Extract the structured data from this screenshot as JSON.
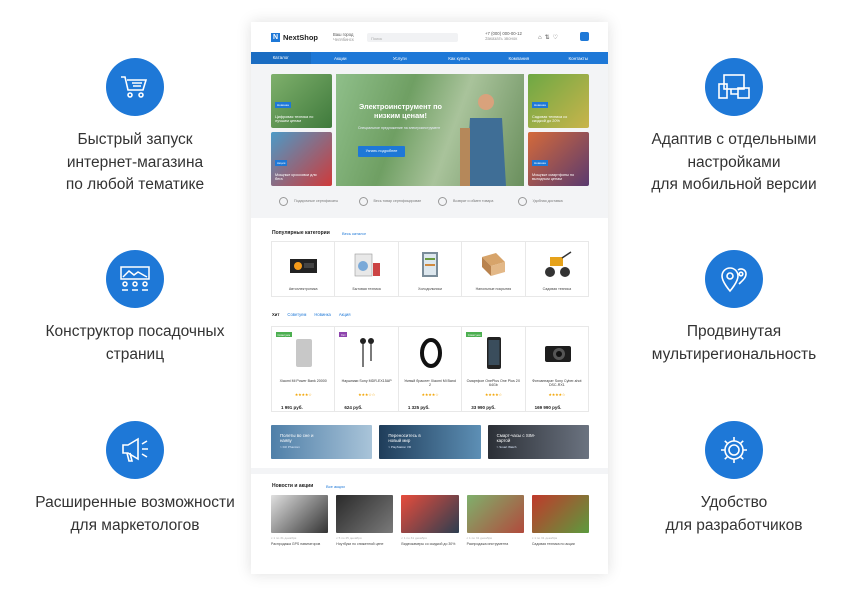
{
  "colors": {
    "accent": "#1e78d7",
    "text": "#333333",
    "background": "#ffffff"
  },
  "features": {
    "left": [
      {
        "icon": "cart-icon",
        "text_lines": [
          "Быстрый запуск",
          "интернет-магазина",
          "по любой тематике"
        ]
      },
      {
        "icon": "landing-constructor-icon",
        "text_lines": [
          "Конструктор посадочных",
          "страниц"
        ]
      },
      {
        "icon": "megaphone-icon",
        "text_lines": [
          "Расширенные возможности",
          "для маркетологов"
        ]
      }
    ],
    "right": [
      {
        "icon": "devices-icon",
        "text_lines": [
          "Адаптив с отдельными",
          "настройками",
          "для мобильной версии"
        ]
      },
      {
        "icon": "map-pins-icon",
        "text_lines": [
          "Продвинутая",
          "мультирегиональность"
        ]
      },
      {
        "icon": "gear-icon",
        "text_lines": [
          "Удобство",
          "для разработчиков"
        ]
      }
    ]
  },
  "mockup": {
    "logo": "NextShop",
    "city_label": "Ваш город",
    "city_value": "Челябинск",
    "search_placeholder": "Поиск",
    "phone": "+7 (000) 000-00-12",
    "callback": "Заказать звонок",
    "nav": [
      "Каталог",
      "Акции",
      "Услуги",
      "Как купить",
      "Компания",
      "Контакты"
    ],
    "hero": {
      "title": "Электроинструмент по низким ценам!",
      "subtitle": "Специальное предложение на электроинструмент",
      "button": "Узнать подробнее",
      "tiles": [
        {
          "badge": "Новинка",
          "text": "Цифровая техника по лучшим ценам"
        },
        {
          "badge": "Акция",
          "text": "Мощные кроссовки для бега"
        },
        {
          "badge": "Новинка",
          "text": "Садовая техника со скидкой до 20%"
        },
        {
          "badge": "Новинка",
          "text": "Мощные смартфоны по выгодным ценам"
        }
      ]
    },
    "advantages": [
      "Подарочные сертификаты",
      "Весь товар сертифицирован",
      "Возврат и обмен товара",
      "Удобная доставка"
    ],
    "categories": {
      "title": "Популярные категории",
      "link": "Весь каталог",
      "items": [
        "Автоэлектроника",
        "Бытовая техника",
        "Холодильники",
        "Напольные покрытия",
        "Садовая техника"
      ]
    },
    "tabs": [
      "Хит",
      "Советуем",
      "Новинка",
      "Акция"
    ],
    "products": [
      {
        "badge": "Советуем",
        "name": "Xiaomi Mi Power Bank 20000",
        "stars": "★★★★☆",
        "price": "1 991 руб."
      },
      {
        "badge": "Хит",
        "name": "Наушники Sony MDR-EX15AP",
        "stars": "★★★☆☆",
        "price": "624 руб."
      },
      {
        "badge": "",
        "name": "Умный браслет Xiaomi Mi Band 2",
        "stars": "★★★★☆",
        "price": "1 325 руб."
      },
      {
        "badge": "Советуем",
        "name": "Смартфон OnePlus One Plus 2X 64Gb",
        "stars": "★★★★☆",
        "price": "33 990 руб."
      },
      {
        "badge": "",
        "name": "Фотоаппарат Sony Cyber-shot DSC-RX1",
        "stars": "★★★★☆",
        "price": "169 990 руб."
      }
    ],
    "banners": [
      {
        "text": "Полеты во сне и наяву",
        "sub": "> DJI Phantom"
      },
      {
        "text": "Переноситесь в новый мир",
        "sub": "> PlayStation VR"
      },
      {
        "text": "Смарт-часы с SIM-картой",
        "sub": "> Smart Watch"
      }
    ],
    "news": {
      "title": "Новости и акции",
      "link": "Все акции",
      "items": [
        {
          "date": "с 1 по 31 декабря",
          "text": "Распродажа GPS навигаторов"
        },
        {
          "date": "с 5 по 25 декабря",
          "text": "Ноутбуки по сниженной цене"
        },
        {
          "date": "с 1 по 31 декабря",
          "text": "Видеокамеры со скидкой до 30%"
        },
        {
          "date": "с 1 по 31 декабря",
          "text": "Распродажа инструмента"
        },
        {
          "date": "с 1 по 31 декабря",
          "text": "Садовая техника по акции"
        }
      ]
    }
  }
}
